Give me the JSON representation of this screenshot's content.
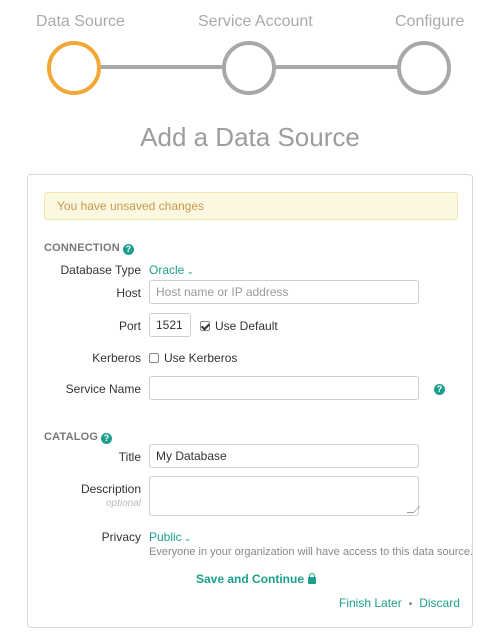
{
  "stepper": {
    "steps": [
      {
        "label": "Data Source",
        "active": true
      },
      {
        "label": "Service Account",
        "active": false
      },
      {
        "label": "Configure",
        "active": false
      }
    ]
  },
  "page": {
    "title": "Add a Data Source"
  },
  "alert": {
    "text": "You have unsaved changes"
  },
  "connection": {
    "heading": "CONNECTION",
    "database_type": {
      "label": "Database Type",
      "value": "Oracle"
    },
    "host": {
      "label": "Host",
      "value": "",
      "placeholder": "Host name or IP address"
    },
    "port": {
      "label": "Port",
      "value": "1521",
      "use_default_label": "Use Default",
      "use_default_checked": true
    },
    "kerberos": {
      "label": "Kerberos",
      "option_label": "Use Kerberos",
      "checked": false
    },
    "service_name": {
      "label": "Service Name",
      "value": ""
    }
  },
  "catalog": {
    "heading": "CATALOG",
    "title": {
      "label": "Title",
      "value": "My Database"
    },
    "description": {
      "label": "Description",
      "sublabel": "optional",
      "value": ""
    },
    "privacy": {
      "label": "Privacy",
      "value": "Public",
      "hint": "Everyone in your organization will have access to this data source."
    }
  },
  "actions": {
    "save_label": "Save and Continue",
    "finish_later_label": "Finish Later",
    "separator": "•",
    "discard_label": "Discard"
  },
  "colors": {
    "accent": "#1b9e8c",
    "active_step": "#f2a736",
    "inactive_step": "#a8a8a8",
    "alert_bg": "#fcf7e1",
    "alert_text": "#c69a4c"
  },
  "icons": {
    "help": "question-circle-icon",
    "chevron": "chevron-down-icon",
    "lock": "lock-icon"
  }
}
